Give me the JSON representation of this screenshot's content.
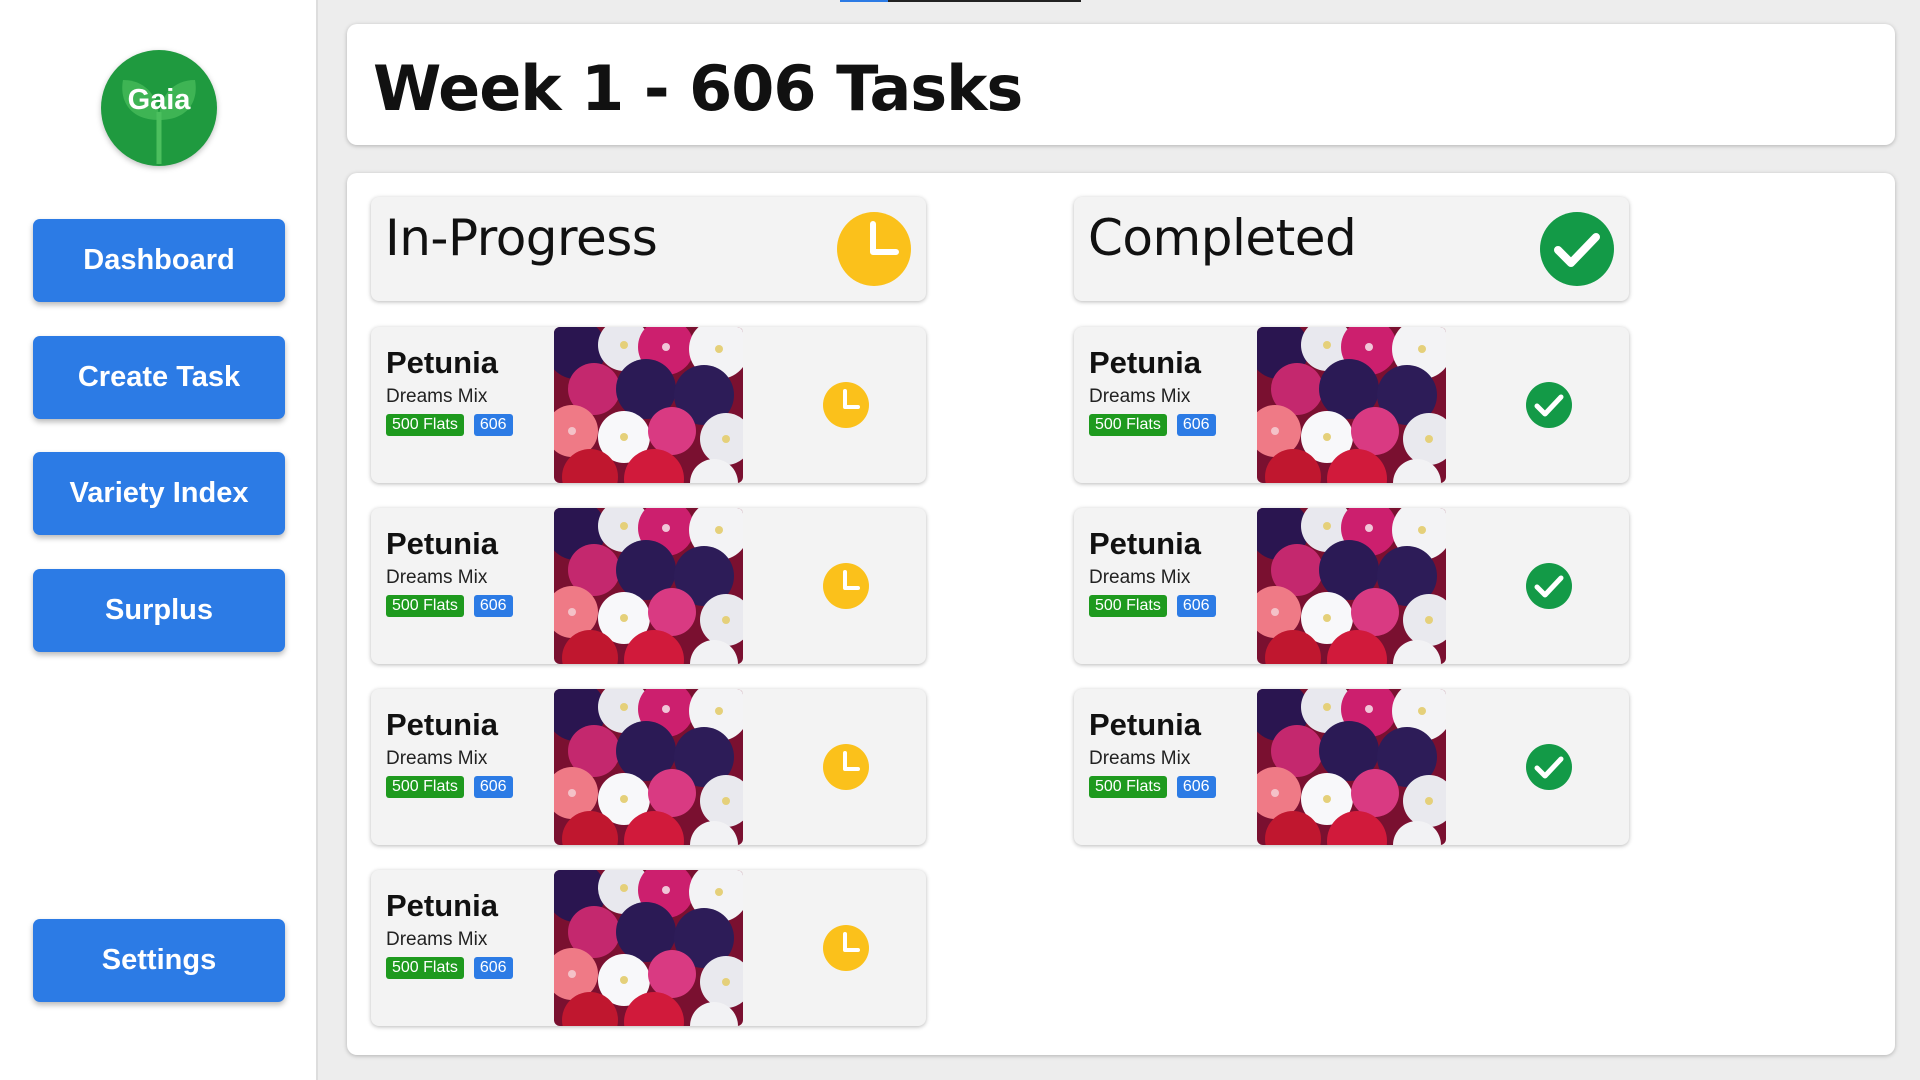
{
  "app": {
    "logo_text": "Gaia"
  },
  "sidebar": {
    "items": [
      {
        "label": "Dashboard"
      },
      {
        "label": "Create Task"
      },
      {
        "label": "Variety Index"
      },
      {
        "label": "Surplus"
      }
    ],
    "settings_label": "Settings"
  },
  "header": {
    "title": "Week 1 - 606 Tasks"
  },
  "columns": {
    "in_progress": {
      "title": "In-Progress",
      "icon": "clock-icon",
      "cards": [
        {
          "name": "Petunia",
          "variety": "Dreams Mix",
          "flats": "500 Flats",
          "count": "606"
        },
        {
          "name": "Petunia",
          "variety": "Dreams Mix",
          "flats": "500 Flats",
          "count": "606"
        },
        {
          "name": "Petunia",
          "variety": "Dreams Mix",
          "flats": "500 Flats",
          "count": "606"
        },
        {
          "name": "Petunia",
          "variety": "Dreams Mix",
          "flats": "500 Flats",
          "count": "606"
        }
      ]
    },
    "completed": {
      "title": "Completed",
      "icon": "check-circle-icon",
      "cards": [
        {
          "name": "Petunia",
          "variety": "Dreams Mix",
          "flats": "500 Flats",
          "count": "606"
        },
        {
          "name": "Petunia",
          "variety": "Dreams Mix",
          "flats": "500 Flats",
          "count": "606"
        },
        {
          "name": "Petunia",
          "variety": "Dreams Mix",
          "flats": "500 Flats",
          "count": "606"
        }
      ]
    }
  },
  "colors": {
    "primary": "#2c7be5",
    "in_progress": "#fbc11b",
    "completed": "#139a47",
    "flats_badge": "#1e9a1e",
    "logo": "#1f9a3f"
  }
}
